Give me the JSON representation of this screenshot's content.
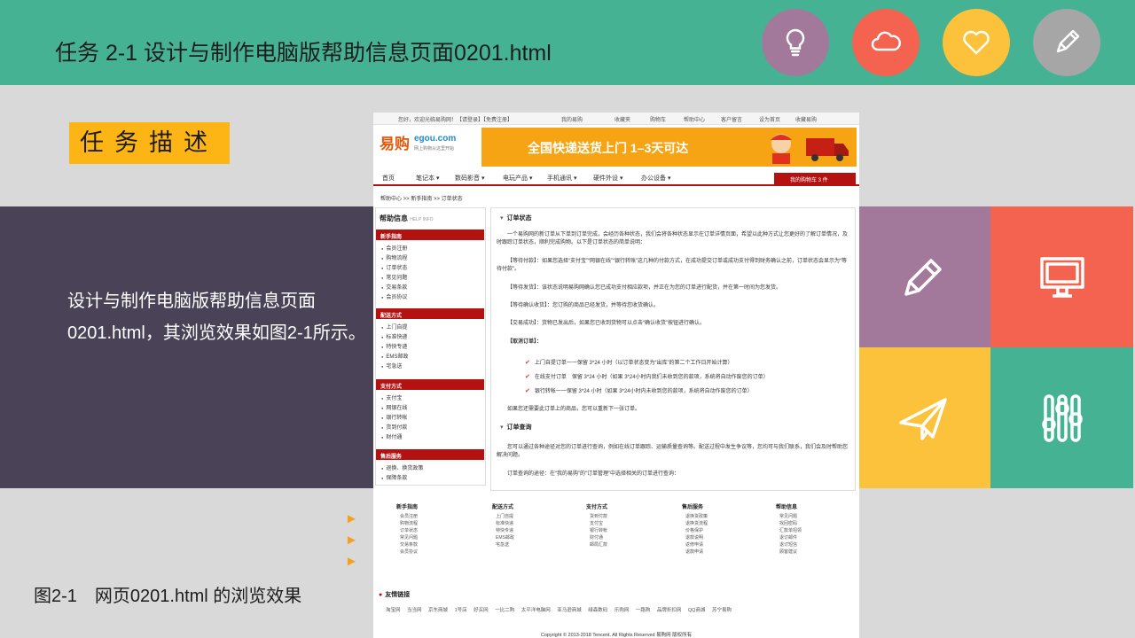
{
  "slide": {
    "title": "任务 2-1 设计与制作电脑版帮助信息页面0201.html",
    "badge": "任务描述",
    "description": "设计与制作电脑版帮助信息页面0201.html，其浏览效果如图2-1所示。",
    "arrows": [
      "►",
      "►",
      "►"
    ],
    "caption": "图2-1　网页0201.html 的浏览效果"
  },
  "colors": {
    "header": "#46b294",
    "band": "#4a4257",
    "badge": "#fdb515",
    "circle_purple": "#a3799b",
    "circle_coral": "#f4634f",
    "circle_yellow": "#fdc23c",
    "circle_gray": "#a6a6a6",
    "tile_purple": "#a3799b",
    "tile_coral": "#f4634f",
    "tile_yellow": "#fdc23c",
    "tile_green": "#46b294"
  },
  "header_icons": [
    "lightbulb-icon",
    "cloud-icon",
    "heart-icon",
    "pencil-icon"
  ],
  "tile_icons": [
    "pencil-icon",
    "monitor-icon",
    "paper-plane-icon",
    "sliders-icon"
  ],
  "webpage": {
    "topbar": {
      "welcome": "您好，欢迎光临易购网！【请登录】【免费注册】",
      "links": [
        "我的易购",
        "收藏夹",
        "购物车",
        "帮助中心",
        "客户留言",
        "设为首页",
        "收藏易购"
      ]
    },
    "logo": {
      "cn": "易购",
      "en": "egou.com",
      "slogan": "网上购物从这里开始"
    },
    "banner": "全国快递送货上门 1–3天可达",
    "nav": [
      "首页",
      "笔记本 ▾",
      "数码影音 ▾",
      "电玩产品 ▾",
      "手机通讯 ▾",
      "硬件外设 ▾",
      "办公设备 ▾"
    ],
    "cart": "我的购物车 3 件",
    "breadcrumb": "帮助中心 >> 新手指南 >> 订单状态",
    "sidebar": {
      "title": "帮助信息",
      "title_en": "HELP INFO",
      "sections": [
        {
          "name": "新手指南",
          "items": [
            "会员注册",
            "购物流程",
            "订单状态",
            "常见问题",
            "交易条款",
            "会员协议"
          ]
        },
        {
          "name": "配送方式",
          "items": [
            "上门自提",
            "标准快递",
            "特快专递",
            "EMS邮政",
            "宅急送"
          ]
        },
        {
          "name": "支付方式",
          "items": [
            "支付宝",
            "网银在线",
            "银行转帐",
            "货到付款",
            "财付通"
          ]
        },
        {
          "name": "售后服务",
          "items": [
            "退换、换货政策",
            "保障条款"
          ]
        }
      ]
    },
    "main": {
      "section1_title": "订单状态",
      "intro": "一个易购网的新订单从下单到订单完成，会经历各种状态，我们会将各种状态显示在订单详情页面，希望以此种方式让您更好的了解订单情况，及时跟踪订单状态，顺利完成购物。以下是订单状态的简单说明：",
      "s1": "【等待付款】：如果您选择“支付宝”“网银在线”“银行转账”这几种的付款方式，在成功提交订单或成功支付得到财务确认之前，订单状态会显示为“等待付款”。",
      "s2": "【等待发货】：该状态说明易购网确认您已成功支付相应款项，并正在为您的订单进行配货，并在第一时间为您发货。",
      "s3": "【等待确认收货】：您订购的商品已经发货，并等待您收货确认。",
      "s4": "【交易成功】：货物已发出后，如果您已收到货物可以点击“确认收货”按钮进行确认。",
      "cancel_title": "【取消订单】：",
      "ticks": [
        "上门自提订单一一保留 3*24 小时（以订单状态变为“出库”的第二个工作日开始计算）",
        "在线支付订单　保留 3*24 小时（如果 3*24小时内我们未收到您的款项，系统将自动作废您的订单）",
        "银行转帐一一保留 3*24 小时（如果 3*24小时内未收到您的款项，系统将自动作废您的订单）"
      ],
      "again": "如果您还需要此订单上的商品，您可以重新下一张订单。",
      "section2_title": "订单查询",
      "query1": "您可以通过各种途径对您的订单进行查询，例如在线订单跟踪、运输质量查询等。配送过程中发生争议等，您均可与我们联系，我们会及时帮助您解决问题。",
      "query2": "订单查询的途径：在“我的易购”的“订单管理”中选择相关的订单进行查询："
    },
    "footer_columns": [
      {
        "head": "新手指南",
        "items": [
          "会员注册",
          "购物流程",
          "订单状态",
          "常见问题",
          "交易条款",
          "会员协议"
        ]
      },
      {
        "head": "配送方式",
        "items": [
          "上门自提",
          "标准快递",
          "特快专递",
          "EMS邮政",
          "宅急送"
        ]
      },
      {
        "head": "支付方式",
        "items": [
          "货到付款",
          "支付宝",
          "银行转帐",
          "财付通",
          "邮局汇款"
        ]
      },
      {
        "head": "售后服务",
        "items": [
          "退换货政策",
          "退换货流程",
          "价格保护",
          "退款说明",
          "返修申请",
          "退款申请"
        ]
      },
      {
        "head": "帮助信息",
        "items": [
          "常见问题",
          "找回密码",
          "汇款单招领",
          "退订邮件",
          "退订短信",
          "顾客建议"
        ]
      }
    ],
    "links_title": "友情链接",
    "links": "淘宝网 当当网 京东商城 1号店 好买网 一比二购 太平洋电脑网 亚马逊商城 绿森数码 乐购网 一路购 品牌折扣网 QQ商城 苏宁易购",
    "copyright": "Copyright © 2013-2018 Tencent. All Rights Reserved 易购网 版权所有"
  }
}
